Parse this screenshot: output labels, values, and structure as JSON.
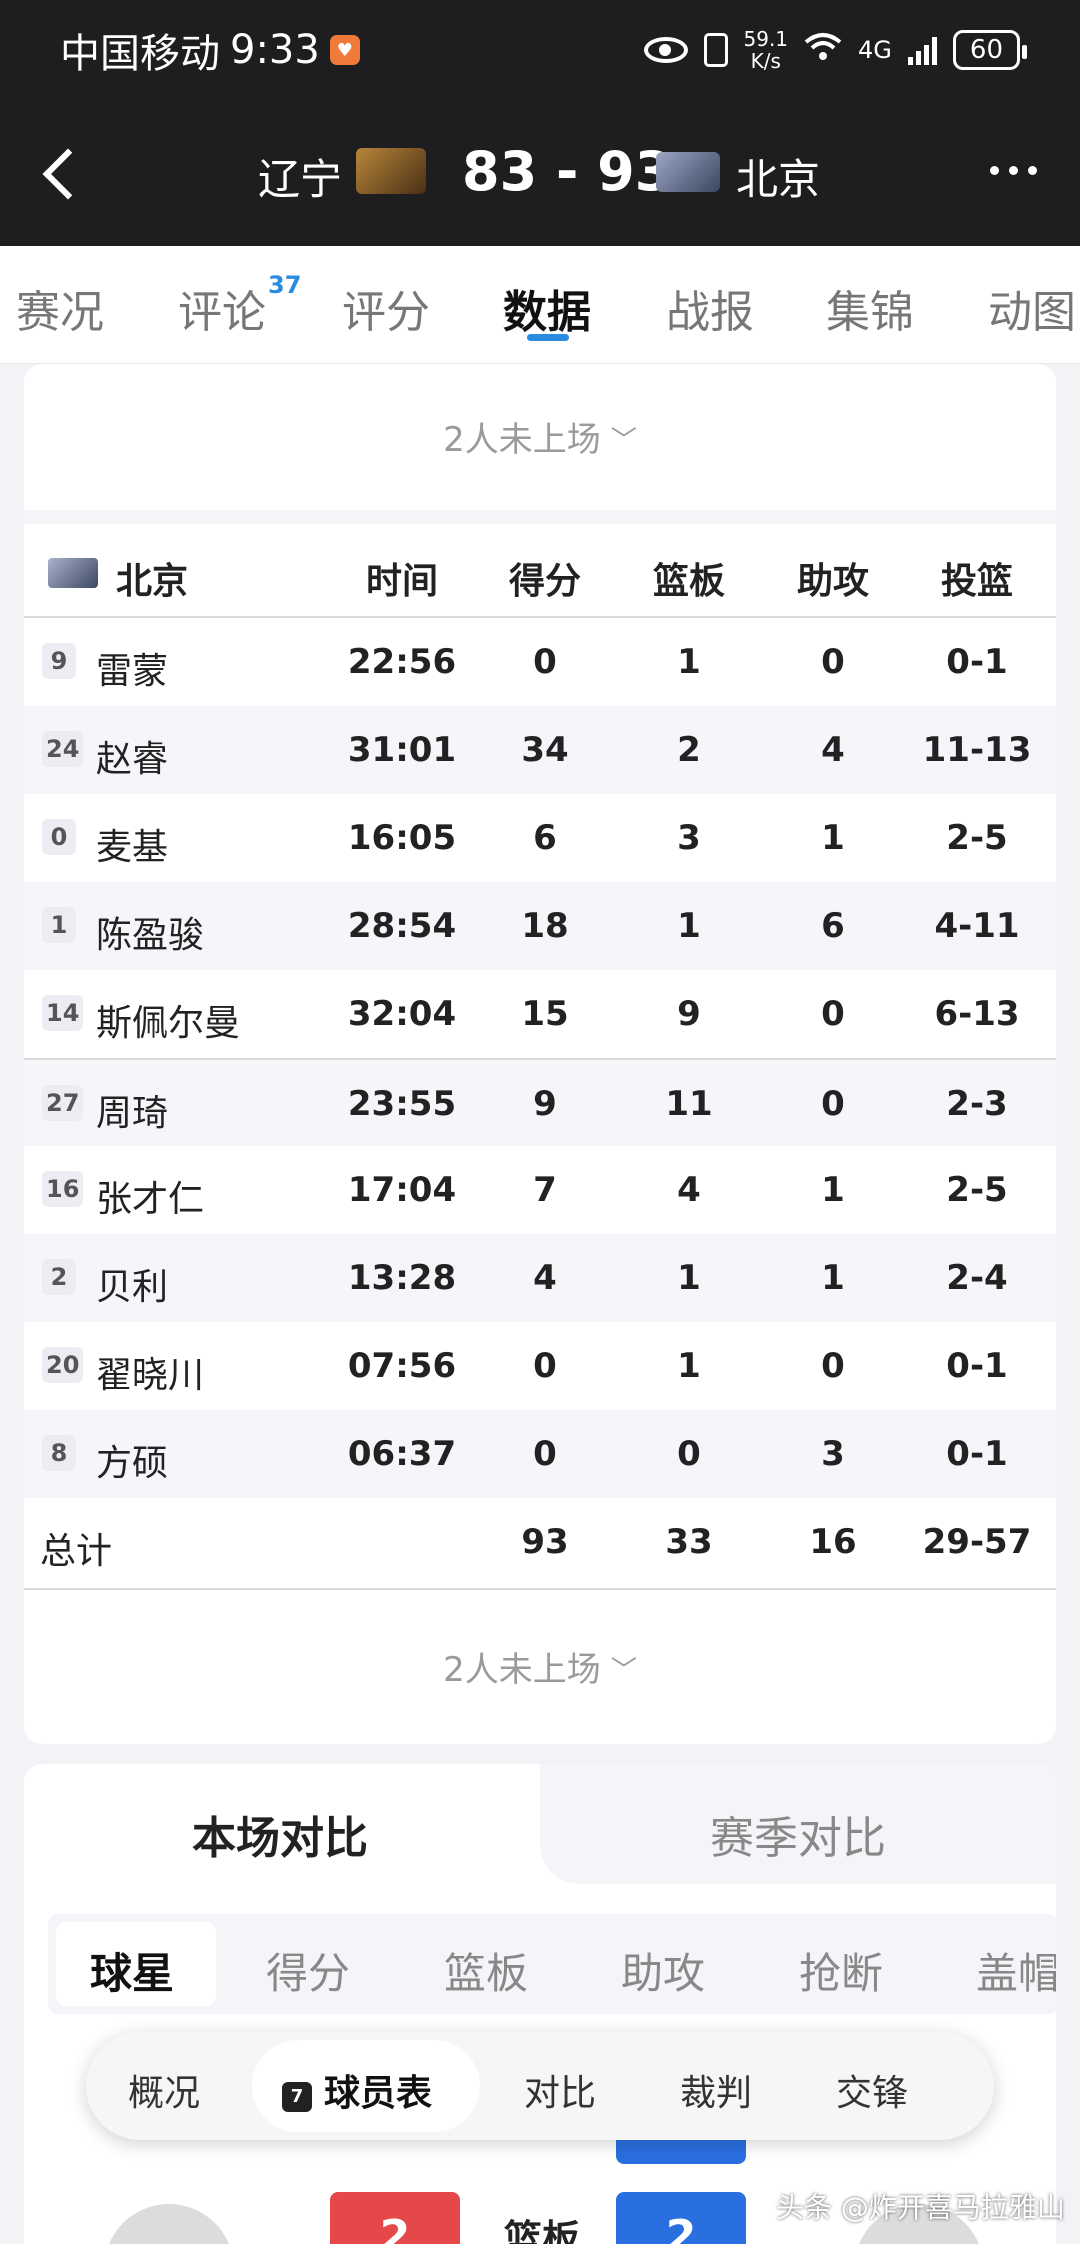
{
  "status_bar": {
    "carrier": "中国移动",
    "time": "9:33",
    "speed_top": "59.1",
    "speed_bottom": "K/s",
    "network": "4G",
    "battery": "60"
  },
  "header": {
    "home_team": "辽宁",
    "score": "83 - 93",
    "away_team": "北京"
  },
  "tabs": [
    {
      "label": "赛况"
    },
    {
      "label": "评论",
      "badge": "37"
    },
    {
      "label": "评分"
    },
    {
      "label": "数据",
      "active": true
    },
    {
      "label": "战报"
    },
    {
      "label": "集锦"
    },
    {
      "label": "动图"
    }
  ],
  "box_score": {
    "dnp_top": "2人未上场",
    "dnp_bottom": "2人未上场",
    "team": "北京",
    "columns": [
      "时间",
      "得分",
      "篮板",
      "助攻",
      "投篮"
    ],
    "players": [
      {
        "number": "9",
        "name": "雷蒙",
        "time": "22:56",
        "pts": "0",
        "reb": "1",
        "ast": "0",
        "fg": "0-1"
      },
      {
        "number": "24",
        "name": "赵睿",
        "time": "31:01",
        "pts": "34",
        "reb": "2",
        "ast": "4",
        "fg": "11-13"
      },
      {
        "number": "0",
        "name": "麦基",
        "time": "16:05",
        "pts": "6",
        "reb": "3",
        "ast": "1",
        "fg": "2-5"
      },
      {
        "number": "1",
        "name": "陈盈骏",
        "time": "28:54",
        "pts": "18",
        "reb": "1",
        "ast": "6",
        "fg": "4-11"
      },
      {
        "number": "14",
        "name": "斯佩尔曼",
        "time": "32:04",
        "pts": "15",
        "reb": "9",
        "ast": "0",
        "fg": "6-13"
      },
      {
        "number": "27",
        "name": "周琦",
        "time": "23:55",
        "pts": "9",
        "reb": "11",
        "ast": "0",
        "fg": "2-3"
      },
      {
        "number": "16",
        "name": "张才仁",
        "time": "17:04",
        "pts": "7",
        "reb": "4",
        "ast": "1",
        "fg": "2-5"
      },
      {
        "number": "2",
        "name": "贝利",
        "time": "13:28",
        "pts": "4",
        "reb": "1",
        "ast": "1",
        "fg": "2-4"
      },
      {
        "number": "20",
        "name": "翟晓川",
        "time": "07:56",
        "pts": "0",
        "reb": "1",
        "ast": "0",
        "fg": "0-1"
      },
      {
        "number": "8",
        "name": "方硕",
        "time": "06:37",
        "pts": "0",
        "reb": "0",
        "ast": "3",
        "fg": "0-1"
      }
    ],
    "total": {
      "label": "总计",
      "pts": "93",
      "reb": "33",
      "ast": "16",
      "fg": "29-57"
    }
  },
  "comparison": {
    "tab_game": "本场对比",
    "tab_season": "赛季对比",
    "sub_tabs": [
      "球星",
      "得分",
      "篮板",
      "助攻",
      "抢断",
      "盖帽"
    ],
    "stat_label": "篮板",
    "home_value": "2",
    "away_value": "2"
  },
  "bottom_nav": {
    "items": [
      "概况",
      "球员表",
      "对比",
      "裁判",
      "交锋"
    ],
    "active": "球员表",
    "icon_text": "7"
  },
  "watermark": "头条 @炸开喜马拉雅山",
  "colors": {
    "accent": "#2a8ce0",
    "header_bg": "#1e1e20",
    "home_red": "#e54848",
    "away_blue": "#2a6fe0"
  }
}
